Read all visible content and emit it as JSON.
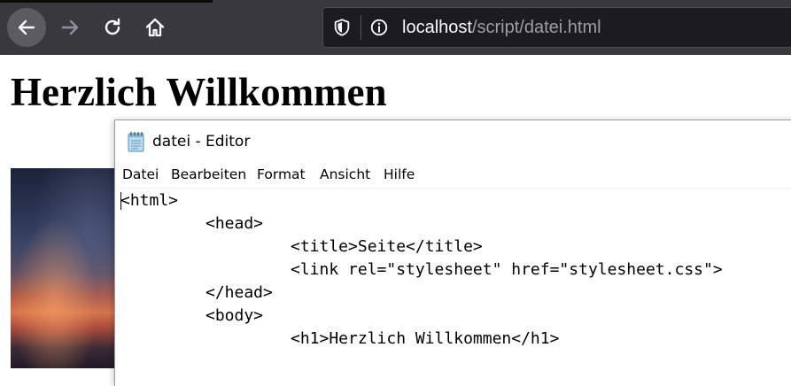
{
  "browser": {
    "url_host": "localhost",
    "url_path": "/script/datei.html",
    "icons": [
      "back-arrow-icon",
      "forward-arrow-icon",
      "reload-icon",
      "home-icon",
      "shield-icon",
      "info-icon"
    ]
  },
  "page": {
    "heading": "Herzlich Willkommen"
  },
  "editor": {
    "title": "datei - Editor",
    "menu": [
      "Datei",
      "Bearbeiten",
      "Format",
      "Ansicht",
      "Hilfe"
    ],
    "lines": [
      "<html>",
      "\t<head>",
      "\t\t<title>Seite</title>",
      "\t\t<link rel=\"stylesheet\" href=\"stylesheet.css\">",
      "\t</head>",
      "\t<body>",
      "\t\t<h1>Herzlich Willkommen</h1>"
    ]
  }
}
